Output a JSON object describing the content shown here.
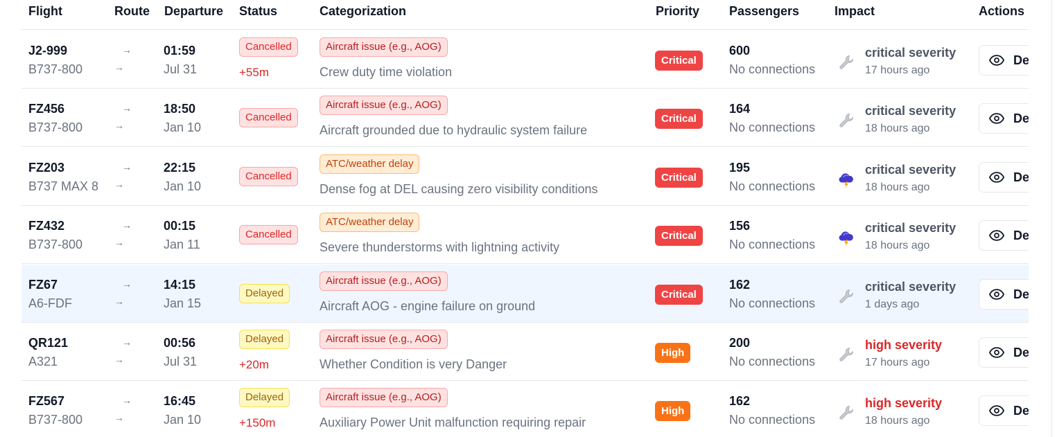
{
  "columns": {
    "flight": "Flight",
    "route": "Route",
    "departure": "Departure",
    "status": "Status",
    "categorization": "Categorization",
    "priority": "Priority",
    "passengers": "Passengers",
    "impact": "Impact",
    "actions": "Actions"
  },
  "route_arrow": "→",
  "details_label": "Details",
  "rows": [
    {
      "flight": "J2-999",
      "aircraft": "B737-800",
      "time": "01:59",
      "date": "Jul 31",
      "status": "Cancelled",
      "delay": "+55m",
      "category": "Aircraft issue (e.g., AOG)",
      "description": "Crew duty time violation",
      "priority": "Critical",
      "passengers": "600",
      "connections": "No connections",
      "impact_icon": "wrench-icon",
      "severity": "critical severity",
      "time_ago": "17 hours ago"
    },
    {
      "flight": "FZ456",
      "aircraft": "B737-800",
      "time": "18:50",
      "date": "Jan 10",
      "status": "Cancelled",
      "delay": "",
      "category": "Aircraft issue (e.g., AOG)",
      "description": "Aircraft grounded due to hydraulic system failure",
      "priority": "Critical",
      "passengers": "164",
      "connections": "No connections",
      "impact_icon": "wrench-icon",
      "severity": "critical severity",
      "time_ago": "18 hours ago"
    },
    {
      "flight": "FZ203",
      "aircraft": "B737 MAX 8",
      "time": "22:15",
      "date": "Jan 10",
      "status": "Cancelled",
      "delay": "",
      "category": "ATC/weather delay",
      "description": "Dense fog at DEL causing zero visibility conditions",
      "priority": "Critical",
      "passengers": "195",
      "connections": "No connections",
      "impact_icon": "storm-cloud-icon",
      "severity": "critical severity",
      "time_ago": "18 hours ago"
    },
    {
      "flight": "FZ432",
      "aircraft": "B737-800",
      "time": "00:15",
      "date": "Jan 11",
      "status": "Cancelled",
      "delay": "",
      "category": "ATC/weather delay",
      "description": "Severe thunderstorms with lightning activity",
      "priority": "Critical",
      "passengers": "156",
      "connections": "No connections",
      "impact_icon": "storm-cloud-icon",
      "severity": "critical severity",
      "time_ago": "18 hours ago"
    },
    {
      "flight": "FZ67",
      "aircraft": "A6-FDF",
      "time": "14:15",
      "date": "Jan 15",
      "status": "Delayed",
      "delay": "",
      "category": "Aircraft issue (e.g., AOG)",
      "description": "Aircraft AOG - engine failure on ground",
      "priority": "Critical",
      "passengers": "162",
      "connections": "No connections",
      "impact_icon": "wrench-icon",
      "severity": "critical severity",
      "time_ago": "1 days ago"
    },
    {
      "flight": "QR121",
      "aircraft": "A321",
      "time": "00:56",
      "date": "Jul 31",
      "status": "Delayed",
      "delay": "+20m",
      "category": "Aircraft issue (e.g., AOG)",
      "description": "Whether Condition is very Danger",
      "priority": "High",
      "passengers": "200",
      "connections": "No connections",
      "impact_icon": "wrench-icon",
      "severity": "high severity",
      "time_ago": "17 hours ago"
    },
    {
      "flight": "FZ567",
      "aircraft": "B737-800",
      "time": "16:45",
      "date": "Jan 10",
      "status": "Delayed",
      "delay": "+150m",
      "category": "Aircraft issue (e.g., AOG)",
      "description": "Auxiliary Power Unit malfunction requiring repair",
      "priority": "High",
      "passengers": "162",
      "connections": "No connections",
      "impact_icon": "wrench-icon",
      "severity": "high severity",
      "time_ago": "18 hours ago"
    }
  ],
  "colors": {
    "critical": "#ef4444",
    "high": "#f97316",
    "cancelled_text": "#dc2626",
    "delayed_text": "#a16207",
    "highlight_row": "#eff6ff"
  }
}
